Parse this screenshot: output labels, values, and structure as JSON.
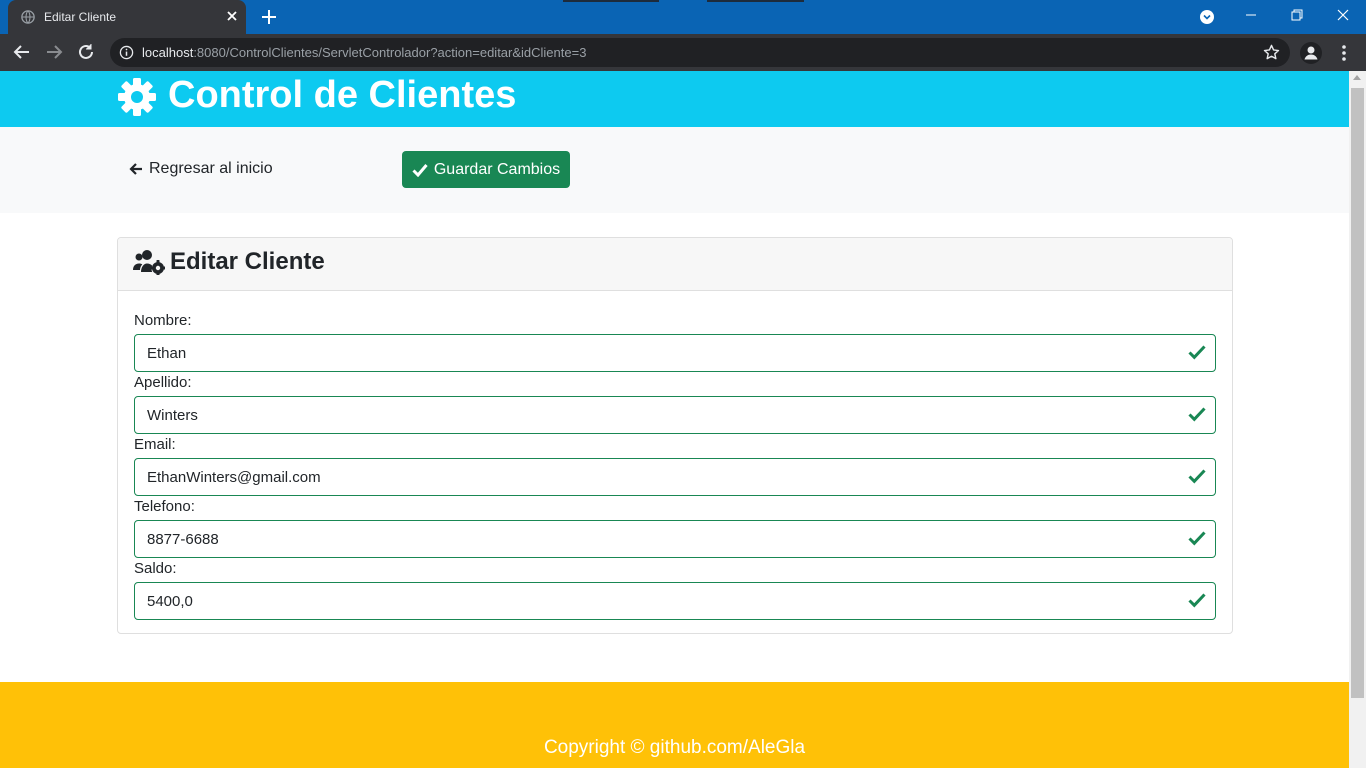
{
  "browser": {
    "tab_title": "Editar Cliente",
    "url_host": "localhost",
    "url_rest": ":8080/ControlClientes/ServletControlador?action=editar&idCliente=3"
  },
  "page": {
    "header_title": "Control de Clientes",
    "back_link": "Regresar al inicio",
    "save_button": "Guardar Cambios",
    "card_title": "Editar Cliente",
    "fields": [
      {
        "label": "Nombre:",
        "value": "Ethan"
      },
      {
        "label": "Apellido:",
        "value": "Winters"
      },
      {
        "label": "Email:",
        "value": "EthanWinters@gmail.com"
      },
      {
        "label": "Telefono:",
        "value": "8877-6688"
      },
      {
        "label": "Saldo:",
        "value": "5400,0"
      }
    ],
    "footer_text": "Copyright © github.com/AleGla"
  },
  "colors": {
    "header": "#0dcaf0",
    "success": "#198754",
    "footer": "#ffc107",
    "action_bar": "#f8f9fa"
  },
  "icons": {
    "header": "cog-icon",
    "back": "arrow-left-icon",
    "save": "check-icon",
    "card": "users-cog-icon",
    "field_valid": "check-icon"
  }
}
